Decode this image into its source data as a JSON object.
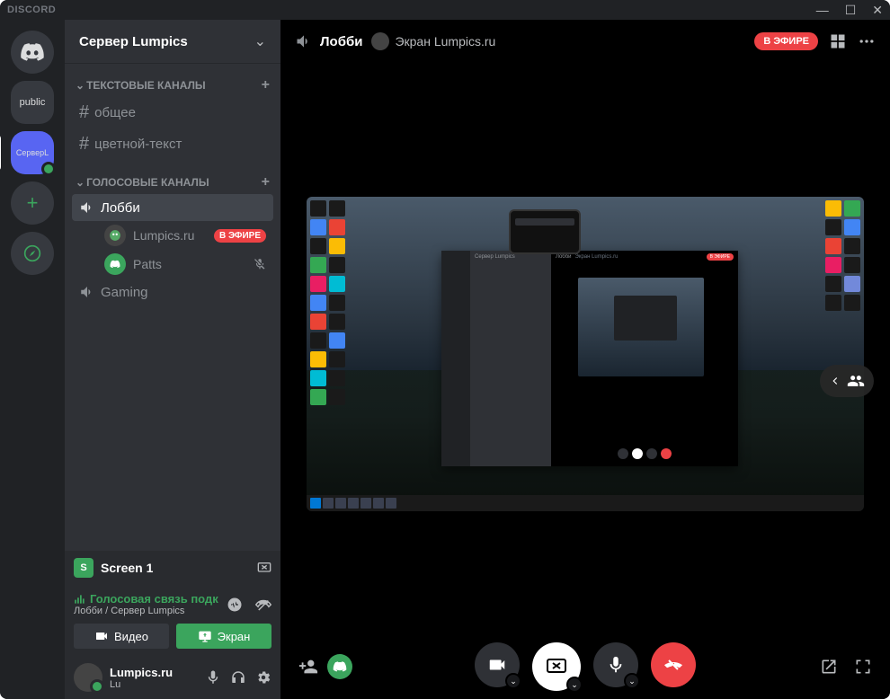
{
  "app": {
    "title": "DISCORD"
  },
  "server": {
    "name": "Сервер Lumpics"
  },
  "serverList": {
    "publicLabel": "public",
    "activeLabel": "СерверL"
  },
  "categories": {
    "text": "ТЕКСТОВЫЕ КАНАЛЫ",
    "voice": "ГОЛОСОВЫЕ КАНАЛЫ"
  },
  "textChannels": {
    "general": "общее",
    "color": "цветной-текст"
  },
  "voiceChannels": {
    "lobby": "Лобби",
    "gaming": "Gaming"
  },
  "voiceUsers": {
    "u1": "Lumpics.ru",
    "u2": "Patts"
  },
  "liveBadge": "В ЭФИРЕ",
  "screenShare": {
    "name": "Screen 1",
    "thumb": "S"
  },
  "voiceStatus": {
    "title": "Голосовая связь подк",
    "sub": "Лобби / Сервер Lumpics"
  },
  "buttons": {
    "video": "Видео",
    "screen": "Экран"
  },
  "user": {
    "name": "Lumpics.ru",
    "status": "Lu"
  },
  "header": {
    "channel": "Лобби",
    "stream": "Экран Lumpics.ru",
    "live": "В ЭФИРЕ"
  }
}
